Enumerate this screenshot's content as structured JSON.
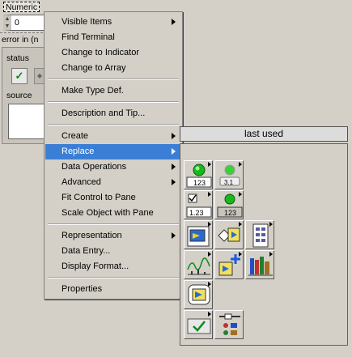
{
  "front_panel": {
    "numeric_label": "Numeric",
    "numeric_value": "0",
    "error_in_label": "error in (n",
    "status_label": "status",
    "source_label": "source"
  },
  "context_menu": {
    "items": [
      {
        "label": "Visible Items",
        "submenu": true
      },
      {
        "label": "Find Terminal",
        "submenu": false
      },
      {
        "label": "Change to Indicator",
        "submenu": false
      },
      {
        "label": "Change to Array",
        "submenu": false
      },
      {
        "label": "Make Type Def.",
        "submenu": false
      },
      {
        "label": "Description and Tip...",
        "submenu": false
      },
      {
        "label": "Create",
        "submenu": true
      },
      {
        "label": "Replace",
        "submenu": true,
        "selected": true
      },
      {
        "label": "Data Operations",
        "submenu": true
      },
      {
        "label": "Advanced",
        "submenu": true
      },
      {
        "label": "Fit Control to Pane",
        "submenu": false
      },
      {
        "label": "Scale Object with Pane",
        "submenu": false
      },
      {
        "label": "Representation",
        "submenu": true
      },
      {
        "label": "Data Entry...",
        "submenu": false
      },
      {
        "label": "Display Format...",
        "submenu": false
      },
      {
        "label": "Properties",
        "submenu": false
      }
    ]
  },
  "palette": {
    "header": "last used",
    "tiles": [
      {
        "name": "numeric-controls-icon"
      },
      {
        "name": "silver-numeric-icon"
      },
      {
        "name": "boolean-numeric-icon"
      },
      {
        "name": "system-controls-icon"
      },
      {
        "name": "io-controls-icon"
      },
      {
        "name": "express-controls-icon"
      },
      {
        "name": "array-matrix-cluster-icon"
      },
      {
        "name": "graph-indicators-icon"
      },
      {
        "name": "add-on-controls-icon"
      },
      {
        "name": "user-libraries-icon"
      },
      {
        "name": "decorations-icon"
      },
      {
        "name": "boolean-button-icon"
      },
      {
        "name": "variant-class-icon"
      }
    ],
    "tile_text": {
      "num_a": "123",
      "num_b": "3.1",
      "num_c": "1.23",
      "num_d": "123"
    }
  },
  "colors": {
    "menu_bg": "#d4d0c8",
    "selection": "#3a7fd5",
    "led_green": "#17b81a"
  }
}
